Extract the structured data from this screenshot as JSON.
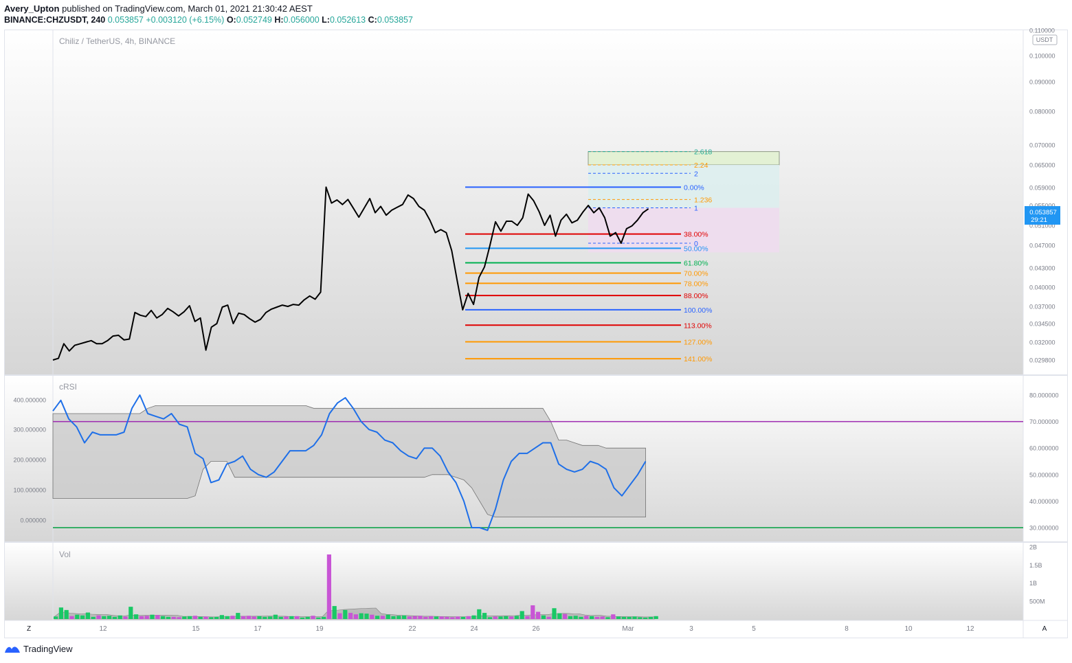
{
  "header": {
    "user": "Avery_Upton",
    "published_text": "published on TradingView.com, March 01, 2021 21:30:42 AEST",
    "symbol": "BINANCE:CHZUSDT, 240",
    "last": "0.053857",
    "change": "+0.003120 (+6.15%)",
    "o_label": "O:",
    "o": "0.052749",
    "h_label": "H:",
    "h": "0.056000",
    "l_label": "L:",
    "l": "0.052613",
    "c_label": "C:",
    "c": "0.053857"
  },
  "main_pane": {
    "legend": "Chiliz / TetherUS, 4h, BINANCE",
    "currency": "USDT",
    "price_badge": "0.053857",
    "price_timer": "29:21",
    "y_ticks": [
      "0.110000",
      "0.100000",
      "0.090000",
      "0.080000",
      "0.070000",
      "0.065000",
      "0.059000",
      "0.055000",
      "0.051000",
      "0.047000",
      "0.043000",
      "0.040000",
      "0.037000",
      "0.034500",
      "0.032000",
      "0.029800"
    ]
  },
  "crsi_pane": {
    "legend": "cRSI",
    "left_ticks": [
      "400.000000",
      "300.000000",
      "200.000000",
      "100.000000",
      "0.000000"
    ],
    "right_ticks": [
      "80.000000",
      "70.000000",
      "60.000000",
      "50.000000",
      "40.000000",
      "30.000000"
    ]
  },
  "vol_pane": {
    "legend": "Vol",
    "right_ticks": [
      "2B",
      "1.5B",
      "1B",
      "500M"
    ]
  },
  "time_axis": {
    "left_btn": "Z",
    "right_btn": "A",
    "labels": [
      "12",
      "15",
      "17",
      "19",
      "22",
      "24",
      "26",
      "Mar",
      "3",
      "5",
      "8",
      "10",
      "12"
    ]
  },
  "fib_retracement": [
    {
      "label": "0.00%",
      "color": "#2962ff"
    },
    {
      "label": "38.00%",
      "color": "#e00000"
    },
    {
      "label": "50.00%",
      "color": "#2196f3"
    },
    {
      "label": "61.80%",
      "color": "#00b050"
    },
    {
      "label": "70.00%",
      "color": "#ff9800"
    },
    {
      "label": "78.00%",
      "color": "#ff9800"
    },
    {
      "label": "88.00%",
      "color": "#e00000"
    },
    {
      "label": "100.00%",
      "color": "#2962ff"
    },
    {
      "label": "113.00%",
      "color": "#e00000"
    },
    {
      "label": "127.00%",
      "color": "#ff9800"
    },
    {
      "label": "141.00%",
      "color": "#ff9800"
    }
  ],
  "fib_extension": [
    {
      "label": "2.618",
      "color": "#22ab94"
    },
    {
      "label": "2.24",
      "color": "#ff9800"
    },
    {
      "label": "2",
      "color": "#2962ff"
    },
    {
      "label": "1.236",
      "color": "#ff9800"
    },
    {
      "label": "1",
      "color": "#2962ff"
    },
    {
      "label": "0",
      "color": "#2962ff"
    }
  ],
  "footer": {
    "brand": "TradingView"
  },
  "chart_data": {
    "type": "line",
    "title": "Chiliz / TetherUS, 4h, BINANCE",
    "price": [
      0.0298,
      0.03,
      0.0318,
      0.0309,
      0.0316,
      0.0318,
      0.032,
      0.0322,
      0.0318,
      0.0318,
      0.0322,
      0.0328,
      0.0329,
      0.0323,
      0.0324,
      0.0361,
      0.0357,
      0.0355,
      0.0364,
      0.0353,
      0.0358,
      0.0367,
      0.0362,
      0.0356,
      0.0362,
      0.0371,
      0.0348,
      0.0353,
      0.031,
      0.034,
      0.0345,
      0.0369,
      0.0372,
      0.0345,
      0.036,
      0.0358,
      0.0352,
      0.0347,
      0.0351,
      0.0361,
      0.0366,
      0.0369,
      0.0372,
      0.037,
      0.0373,
      0.0372,
      0.038,
      0.0386,
      0.0381,
      0.0392,
      0.0591,
      0.0555,
      0.0562,
      0.0552,
      0.0563,
      0.0544,
      0.0526,
      0.0545,
      0.0565,
      0.0535,
      0.0548,
      0.053,
      0.054,
      0.0546,
      0.0552,
      0.0573,
      0.0565,
      0.0548,
      0.054,
      0.052,
      0.0495,
      0.0501,
      0.0495,
      0.046,
      0.041,
      0.0365,
      0.039,
      0.0373,
      0.0415,
      0.0432,
      0.047,
      0.0517,
      0.0498,
      0.0518,
      0.0518,
      0.051,
      0.0525,
      0.0575,
      0.056,
      0.0537,
      0.051,
      0.053,
      0.0488,
      0.052,
      0.0532,
      0.0515,
      0.052,
      0.0536,
      0.055,
      0.0535,
      0.0545,
      0.0525,
      0.0488,
      0.0495,
      0.0474,
      0.0503,
      0.0509,
      0.052,
      0.0535,
      0.0543
    ],
    "crsi": [
      74,
      78,
      71,
      68,
      62,
      66,
      65,
      65,
      65,
      66,
      75,
      80,
      73,
      72,
      71,
      73,
      69,
      68,
      58,
      56,
      47,
      48,
      54,
      55,
      57,
      52,
      50,
      49,
      51,
      55,
      59,
      59,
      59,
      61,
      65,
      73,
      77,
      79,
      75,
      70,
      67,
      66,
      63,
      62,
      59,
      57,
      56,
      60,
      60,
      57,
      51,
      47,
      40,
      30,
      30,
      29,
      37,
      48,
      55,
      58,
      58,
      60,
      62,
      62,
      54,
      52,
      51,
      52,
      55,
      54,
      52,
      45,
      42,
      46,
      50,
      55
    ],
    "crsi_upper_band": [
      73,
      73,
      73,
      73,
      73,
      73,
      73,
      73,
      73,
      73,
      73,
      73,
      75,
      76,
      76,
      76,
      76,
      76,
      76,
      76,
      76,
      76,
      76,
      76,
      76,
      76,
      76,
      76,
      76,
      76,
      76,
      76,
      76,
      75,
      75,
      75,
      75,
      75,
      75,
      75,
      75,
      75,
      75,
      75,
      75,
      75,
      75,
      75,
      75,
      75,
      75,
      75,
      75,
      75,
      75,
      75,
      75,
      75,
      75,
      75,
      75,
      75,
      75,
      70,
      63,
      63,
      62,
      61,
      61,
      61,
      60,
      60,
      60,
      60,
      60,
      60
    ],
    "crsi_lower_band": [
      41,
      41,
      41,
      41,
      41,
      41,
      41,
      41,
      41,
      41,
      41,
      41,
      41,
      41,
      41,
      41,
      41,
      41,
      42,
      52,
      55,
      55,
      55,
      49,
      49,
      49,
      49,
      49,
      49,
      49,
      49,
      49,
      49,
      49,
      49,
      49,
      49,
      49,
      49,
      49,
      49,
      49,
      49,
      49,
      49,
      49,
      49,
      49,
      50,
      50,
      50,
      49,
      48,
      45,
      40,
      35,
      34,
      34,
      34,
      34,
      34,
      34,
      34,
      34,
      34,
      34,
      34,
      34,
      34,
      34,
      34,
      34,
      34,
      34,
      34,
      34
    ],
    "crsi_levels": [
      70,
      30
    ],
    "volume_M": [
      70,
      320,
      250,
      80,
      120,
      100,
      180,
      60,
      100,
      80,
      90,
      60,
      100,
      70,
      340,
      130,
      80,
      90,
      120,
      110,
      80,
      60,
      60,
      50,
      70,
      80,
      90,
      60,
      70,
      50,
      60,
      110,
      80,
      90,
      170,
      80,
      90,
      70,
      80,
      60,
      70,
      120,
      60,
      70,
      80,
      80,
      40,
      60,
      90,
      40,
      60,
      1790,
      360,
      160,
      250,
      170,
      130,
      160,
      150,
      120,
      90,
      90,
      120,
      80,
      90,
      100,
      70,
      80,
      90,
      60,
      80,
      70,
      70,
      60,
      50,
      70,
      60,
      80,
      100,
      270,
      170,
      50,
      70,
      70,
      80,
      70,
      90,
      220,
      80,
      380,
      200,
      100,
      60,
      300,
      160,
      140,
      80,
      90,
      60,
      90,
      80,
      60,
      70,
      50,
      130,
      70,
      60,
      60,
      70,
      50,
      40,
      60,
      80
    ]
  }
}
